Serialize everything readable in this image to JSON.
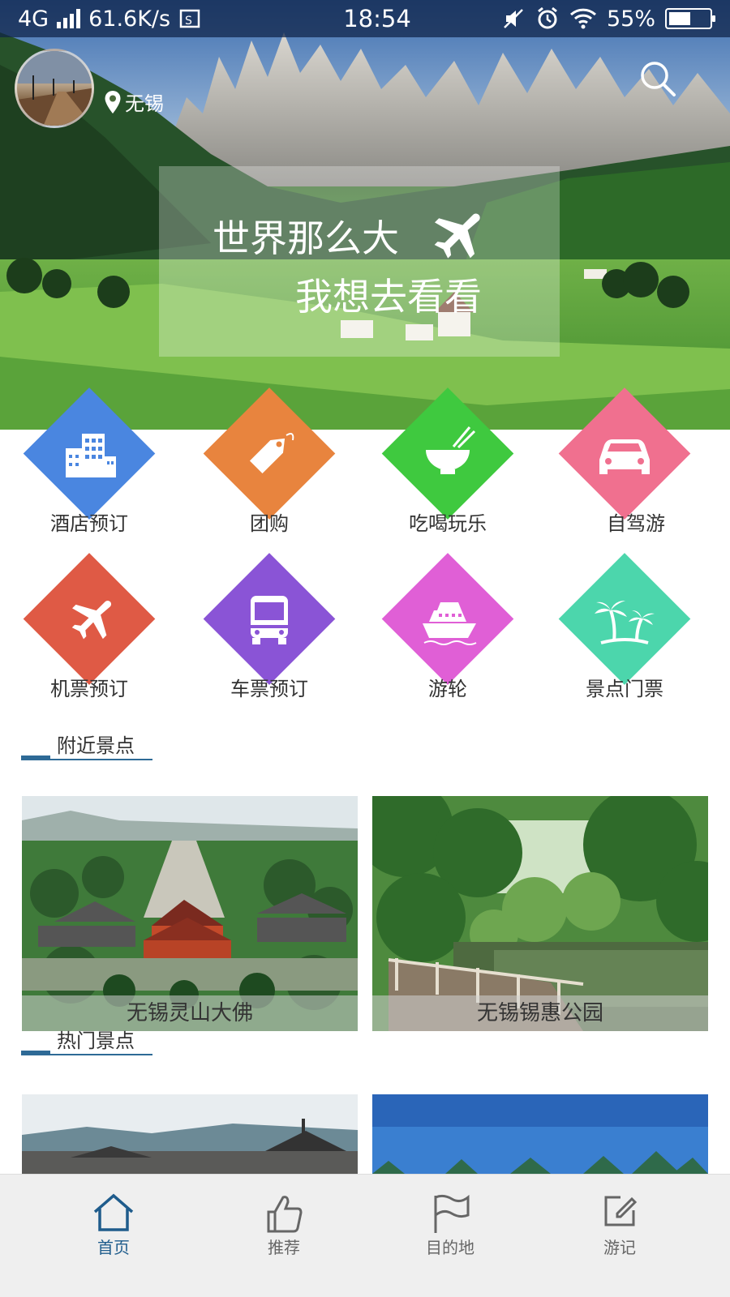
{
  "status_bar": {
    "network": "4G",
    "speed": "61.6K/s",
    "time": "18:54",
    "battery": "55%",
    "battery_level": 0.55
  },
  "header": {
    "location": "无锡",
    "slogan_line1": "世界那么大",
    "slogan_line2": "我想去看看"
  },
  "categories": [
    {
      "label": "酒店预订",
      "icon": "building-icon",
      "color": "#4a86e0"
    },
    {
      "label": "团购",
      "icon": "tag-icon",
      "color": "#e8843e"
    },
    {
      "label": "吃喝玩乐",
      "icon": "bowl-icon",
      "color": "#3fc93f"
    },
    {
      "label": "自驾游",
      "icon": "car-icon",
      "color": "#f0708f"
    },
    {
      "label": "机票预订",
      "icon": "plane-icon",
      "color": "#df5a45"
    },
    {
      "label": "车票预订",
      "icon": "bus-icon",
      "color": "#8a54d6"
    },
    {
      "label": "游轮",
      "icon": "ship-icon",
      "color": "#e05fd6"
    },
    {
      "label": "景点门票",
      "icon": "palm-icon",
      "color": "#4cd6ac"
    }
  ],
  "nearby": {
    "title": "附近景点",
    "items": [
      {
        "name": "无锡灵山大佛"
      },
      {
        "name": "无锡锡惠公园"
      }
    ]
  },
  "hot": {
    "title": "热门景点"
  },
  "bottom_nav": [
    {
      "label": "首页",
      "icon": "home-icon",
      "active": true
    },
    {
      "label": "推荐",
      "icon": "thumbs-up-icon",
      "active": false
    },
    {
      "label": "目的地",
      "icon": "flag-icon",
      "active": false
    },
    {
      "label": "游记",
      "icon": "edit-icon",
      "active": false
    }
  ]
}
